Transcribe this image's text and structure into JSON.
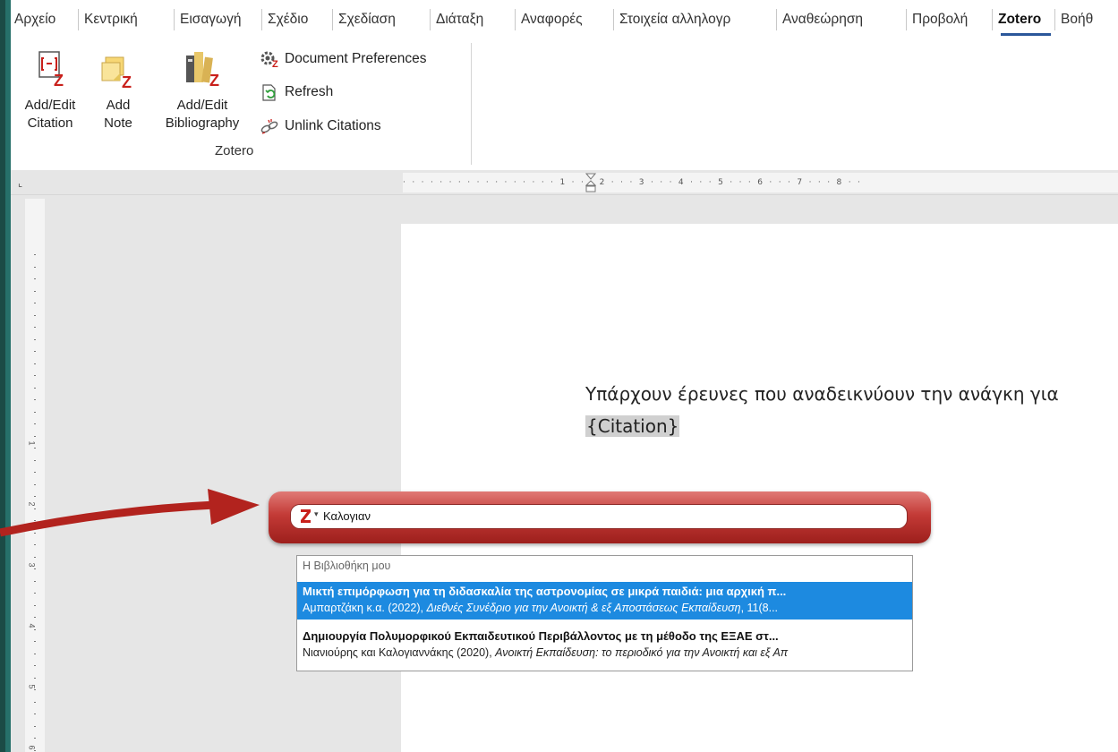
{
  "tabs": [
    {
      "label": "Αρχείο"
    },
    {
      "label": "Κεντρική"
    },
    {
      "label": "Εισαγωγή"
    },
    {
      "label": "Σχέδιο"
    },
    {
      "label": "Σχεδίαση"
    },
    {
      "label": "Διάταξη"
    },
    {
      "label": "Αναφορές"
    },
    {
      "label": "Στοιχεία αλληλογρ"
    },
    {
      "label": "Αναθεώρηση"
    },
    {
      "label": "Προβολή"
    },
    {
      "label": "Zotero"
    },
    {
      "label": "Βοήθ"
    }
  ],
  "active_tab": "Zotero",
  "ribbon": {
    "add_edit_citation": {
      "line1": "Add/Edit",
      "line2": "Citation"
    },
    "add_note": {
      "line1": "Add",
      "line2": "Note"
    },
    "add_edit_bibliography": {
      "line1": "Add/Edit",
      "line2": "Bibliography"
    },
    "document_preferences": "Document Preferences",
    "refresh": "Refresh",
    "unlink_citations": "Unlink Citations",
    "group_label": "Zotero"
  },
  "ruler": {
    "marks": "· · · · · · · · · · · · · · ·   · · 1 · · · 2 · · · 3 · · · 4 · · · 5 · · · 6 · · · 7 · · · 8 · ·"
  },
  "document": {
    "body_text": "Υπάρχουν έρευνες που αναδεικνύουν την ανάγκη για",
    "citation_placeholder": "{Citation}"
  },
  "quick_format": {
    "query": "Καλογιαν"
  },
  "results": {
    "header": "Η Βιβλιοθήκη μου",
    "items": [
      {
        "title": "Μικτή επιμόρφωση για τη διδασκαλία της αστρονομίας σε μικρά παιδιά: μια αρχική π...",
        "authors_year": "Αμπαρτζάκη κ.α. (2022), ",
        "source": "Διεθνές Συνέδριο για την Ανοικτή & εξ Αποστάσεως Εκπαίδευση",
        "extra": ", 11(8...",
        "selected": true
      },
      {
        "title": "Δημιουργία Πολυμορφικού Εκπαιδευτικού Περιβάλλοντος με τη μέθοδο της ΕΞΑΕ στ...",
        "authors_year": "Νιανιούρης και Καλογιαννάκης (2020), ",
        "source": "Ανοικτή Εκπαίδευση: το περιοδικό για την Ανοικτή και εξ Απ",
        "extra": "",
        "selected": false
      }
    ]
  },
  "colors": {
    "quick_format_bar": "#c33a36",
    "selected_row": "#1d8ae0",
    "active_tab_underline": "#2b579a"
  }
}
